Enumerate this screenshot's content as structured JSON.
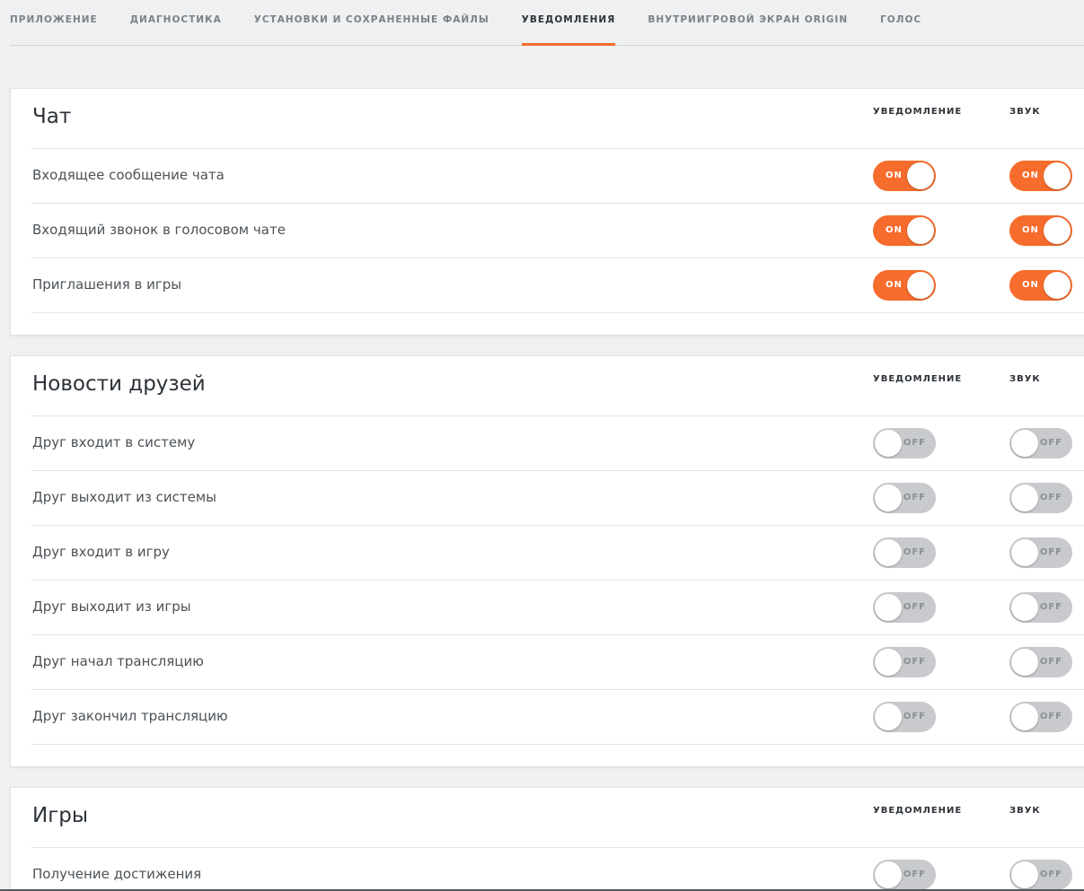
{
  "tabs": [
    {
      "label": "ПРИЛОЖЕНИЕ",
      "active": false
    },
    {
      "label": "ДИАГНОСТИКА",
      "active": false
    },
    {
      "label": "УСТАНОВКИ И СОХРАНЕННЫЕ ФАЙЛЫ",
      "active": false
    },
    {
      "label": "УВЕДОМЛЕНИЯ",
      "active": true
    },
    {
      "label": "ВНУТРИИГРОВОЙ ЭКРАН ORIGIN",
      "active": false
    },
    {
      "label": "ГОЛОС",
      "active": false
    }
  ],
  "columns": {
    "notification": "УВЕДОМЛЕНИЕ",
    "sound": "ЗВУК"
  },
  "toggle_text": {
    "on": "ON",
    "off": "OFF"
  },
  "colors": {
    "accent": "#f56c2d",
    "off": "#c8cacd"
  },
  "sections": [
    {
      "title": "Чат",
      "rows": [
        {
          "label": "Входящее сообщение чата",
          "notification": true,
          "sound": true
        },
        {
          "label": "Входящий звонок в голосовом чате",
          "notification": true,
          "sound": true
        },
        {
          "label": "Приглашения в игры",
          "notification": true,
          "sound": true
        }
      ]
    },
    {
      "title": "Новости друзей",
      "rows": [
        {
          "label": "Друг входит в систему",
          "notification": false,
          "sound": false
        },
        {
          "label": "Друг выходит из системы",
          "notification": false,
          "sound": false
        },
        {
          "label": "Друг входит в игру",
          "notification": false,
          "sound": false
        },
        {
          "label": "Друг выходит из игры",
          "notification": false,
          "sound": false
        },
        {
          "label": "Друг начал трансляцию",
          "notification": false,
          "sound": false
        },
        {
          "label": "Друг закончил трансляцию",
          "notification": false,
          "sound": false
        }
      ]
    },
    {
      "title": "Игры",
      "rows": [
        {
          "label": "Получение достижения",
          "notification": false,
          "sound": false
        }
      ]
    }
  ]
}
